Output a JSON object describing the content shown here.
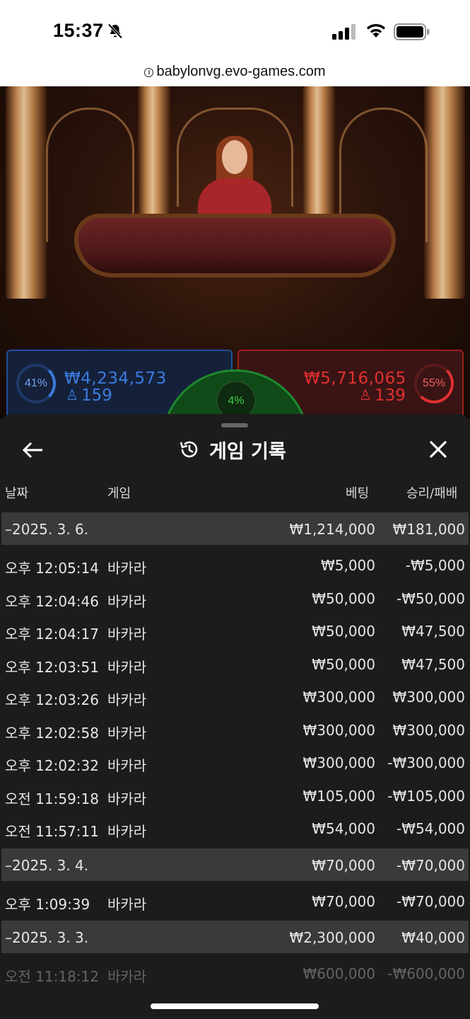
{
  "status": {
    "time": "15:37"
  },
  "browser": {
    "url": "babylonvg.evo-games.com"
  },
  "table": {
    "player": {
      "percent": "41%",
      "amount": "₩4,234,573",
      "players": "159",
      "color": "#3b7be0"
    },
    "banker": {
      "percent": "55%",
      "amount": "₩5,716,065",
      "players": "139",
      "color": "#e03030"
    },
    "tie": {
      "percent": "4%",
      "color": "#2ecc40"
    }
  },
  "sheet": {
    "title": "게임 기록",
    "columns": {
      "date": "날짜",
      "game": "게임",
      "bet": "베팅",
      "result": "승리/패배"
    },
    "rows": [
      {
        "type": "date",
        "time": "–2025. 3. 6.",
        "game": "",
        "bet": "₩1,214,000",
        "result": "₩181,000"
      },
      {
        "type": "entry",
        "time": "오후 12:05:14",
        "game": "바카라",
        "bet": "₩5,000",
        "result": "-₩5,000"
      },
      {
        "type": "entry",
        "time": "오후 12:04:46",
        "game": "바카라",
        "bet": "₩50,000",
        "result": "-₩50,000"
      },
      {
        "type": "entry",
        "time": "오후 12:04:17",
        "game": "바카라",
        "bet": "₩50,000",
        "result": "₩47,500"
      },
      {
        "type": "entry",
        "time": "오후 12:03:51",
        "game": "바카라",
        "bet": "₩50,000",
        "result": "₩47,500"
      },
      {
        "type": "entry",
        "time": "오후 12:03:26",
        "game": "바카라",
        "bet": "₩300,000",
        "result": "₩300,000"
      },
      {
        "type": "entry",
        "time": "오후 12:02:58",
        "game": "바카라",
        "bet": "₩300,000",
        "result": "₩300,000"
      },
      {
        "type": "entry",
        "time": "오후 12:02:32",
        "game": "바카라",
        "bet": "₩300,000",
        "result": "-₩300,000"
      },
      {
        "type": "entry",
        "time": "오전 11:59:18",
        "game": "바카라",
        "bet": "₩105,000",
        "result": "-₩105,000"
      },
      {
        "type": "entry",
        "time": "오전 11:57:11",
        "game": "바카라",
        "bet": "₩54,000",
        "result": "-₩54,000"
      },
      {
        "type": "date",
        "time": "–2025. 3. 4.",
        "game": "",
        "bet": "₩70,000",
        "result": "-₩70,000"
      },
      {
        "type": "entry",
        "time": "오후 1:09:39",
        "game": "바카라",
        "bet": "₩70,000",
        "result": "-₩70,000"
      },
      {
        "type": "date",
        "time": "–2025. 3. 3.",
        "game": "",
        "bet": "₩2,300,000",
        "result": "₩40,000"
      },
      {
        "type": "entry",
        "time": "오전 11:18:12",
        "game": "바카라",
        "bet": "₩600,000",
        "result": "-₩600,000"
      }
    ]
  }
}
